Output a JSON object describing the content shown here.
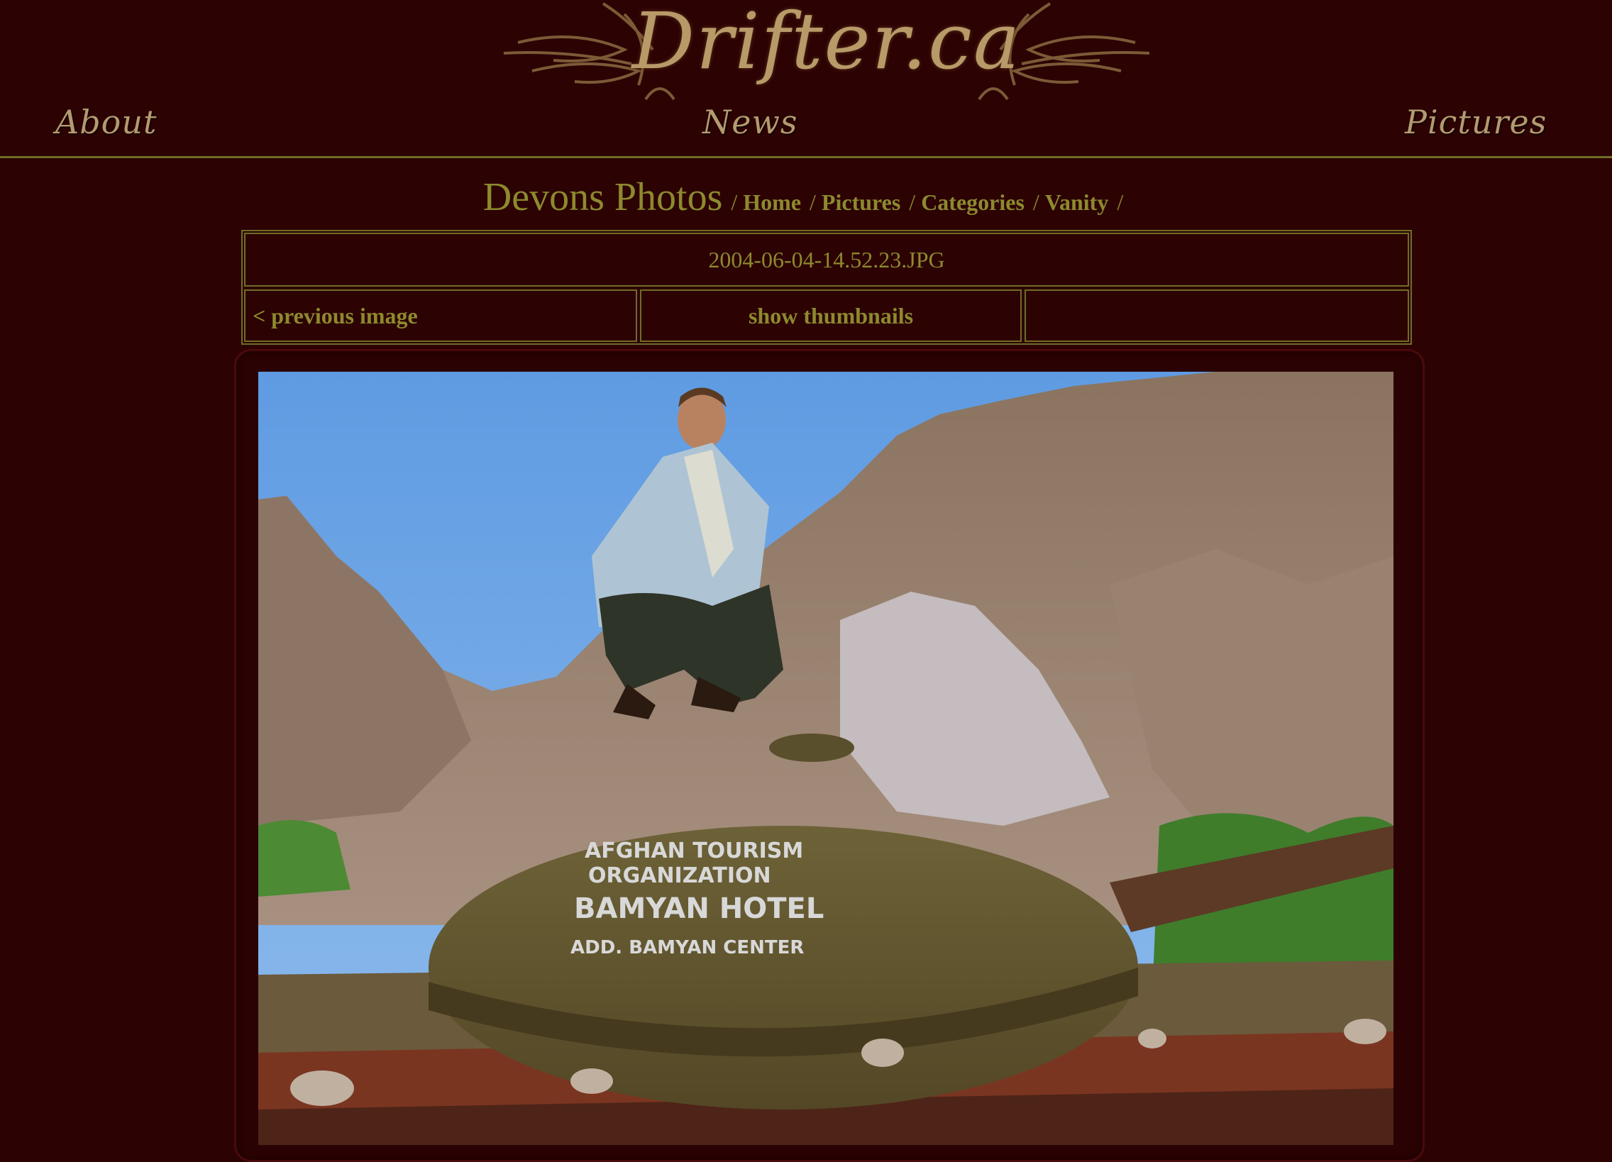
{
  "header": {
    "logo_text": "Drifter.ca",
    "nav": {
      "about": "About",
      "news": "News",
      "pictures": "Pictures"
    }
  },
  "gallery": {
    "title": "Devons Photos",
    "breadcrumbs": [
      "Home",
      "Pictures",
      "Categories",
      "Vanity"
    ],
    "separator": "/"
  },
  "image_info": {
    "filename": "2004-06-04-14.52.23.JPG",
    "previous_label": "< previous image",
    "thumbnails_label": "show thumbnails",
    "next_label": ""
  },
  "photo": {
    "tank_text": [
      "AFGHAN TOURISM",
      "ORGANIZATION",
      "BAMYAN HOTEL",
      "ADD. BAMYAN CENTER"
    ]
  },
  "colors": {
    "background": "#2d0203",
    "accent": "#8c8a2e",
    "border": "#6f6d28",
    "logo": "#b89a68"
  }
}
